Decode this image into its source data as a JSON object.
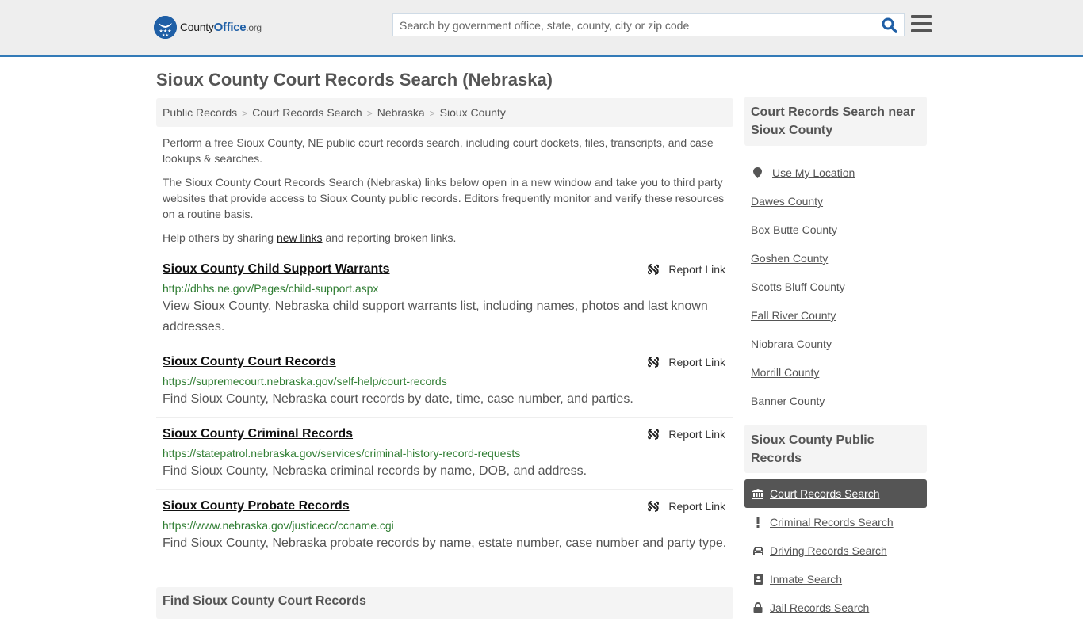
{
  "header": {
    "logo": {
      "name_part1": "County",
      "name_part2": "Office",
      "name_part3": ".org"
    },
    "search": {
      "placeholder": "Search by government office, state, county, city or zip code",
      "value": ""
    },
    "colors": {
      "brand": "#1f5fa6",
      "header_border": "#337ab7"
    }
  },
  "page": {
    "title": "Sioux County Court Records Search (Nebraska)",
    "breadcrumb": [
      "Public Records",
      "Court Records Search",
      "Nebraska",
      "Sioux County"
    ],
    "intro": {
      "p1": "Perform a free Sioux County, NE public court records search, including court dockets, files, transcripts, and case lookups & searches.",
      "p2": "The Sioux County Court Records Search (Nebraska) links below open in a new window and take you to third party websites that provide access to Sioux County public records. Editors frequently monitor and verify these resources on a routine basis.",
      "p3_before": "Help others by sharing ",
      "p3_link": "new links",
      "p3_after": " and reporting broken links."
    },
    "report_label": "Report Link",
    "results": [
      {
        "title": "Sioux County Child Support Warrants",
        "url": "http://dhhs.ne.gov/Pages/child-support.aspx",
        "desc": "View Sioux County, Nebraska child support warrants list, including names, photos and last known addresses."
      },
      {
        "title": "Sioux County Court Records",
        "url": "https://supremecourt.nebraska.gov/self-help/court-records",
        "desc": "Find Sioux County, Nebraska court records by date, time, case number, and parties."
      },
      {
        "title": "Sioux County Criminal Records",
        "url": "https://statepatrol.nebraska.gov/services/criminal-history-record-requests",
        "desc": "Find Sioux County, Nebraska criminal records by name, DOB, and address."
      },
      {
        "title": "Sioux County Probate Records",
        "url": "https://www.nebraska.gov/justicecc/ccname.cgi",
        "desc": "Find Sioux County, Nebraska probate records by name, estate number, case number and party type."
      }
    ],
    "find_heading": "Find Sioux County Court Records"
  },
  "sidebar": {
    "near_heading": "Court Records Search near Sioux County",
    "use_location": "Use My Location",
    "near_counties": [
      "Dawes County",
      "Box Butte County",
      "Goshen County",
      "Scotts Bluff County",
      "Fall River County",
      "Niobrara County",
      "Morrill County",
      "Banner County"
    ],
    "public_records_heading": "Sioux County Public Records",
    "public_records": [
      {
        "label": "Court Records Search",
        "icon": "courthouse-icon",
        "active": true
      },
      {
        "label": "Criminal Records Search",
        "icon": "exclamation-icon",
        "active": false
      },
      {
        "label": "Driving Records Search",
        "icon": "car-icon",
        "active": false
      },
      {
        "label": "Inmate Search",
        "icon": "id-badge-icon",
        "active": false
      },
      {
        "label": "Jail Records Search",
        "icon": "lock-icon",
        "active": false
      }
    ]
  }
}
